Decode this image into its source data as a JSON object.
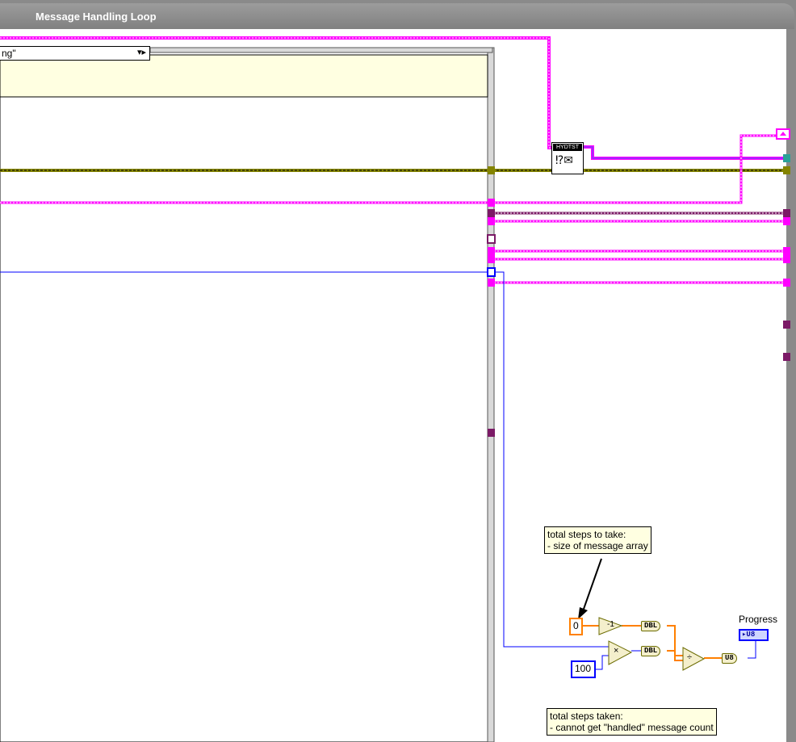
{
  "loop": {
    "title": "Message Handling Loop"
  },
  "case_structure": {
    "selector_text": "ng\"",
    "selector_arrow": "▾▸"
  },
  "subvi": {
    "label": "HYDTST",
    "icon": "message-queue-icon"
  },
  "comments": {
    "total_steps_to_take": {
      "line1": "total steps to take:",
      "line2": "- size of message array"
    },
    "total_steps_taken": {
      "line1": "total steps taken:",
      "line2": "- cannot get \"handled\" message count"
    }
  },
  "constants": {
    "zero": "0",
    "hundred": "100"
  },
  "nodes": {
    "decrement": "-1",
    "multiply": "×",
    "divide": "÷",
    "to_dbl_1": "DBL",
    "to_dbl_2": "DBL",
    "to_u8": "U8"
  },
  "indicator": {
    "label": "Progress",
    "type": "U8"
  },
  "colors": {
    "cluster_pink": "#ff00ff",
    "reference_purple": "#7b1a66",
    "error_olive": "#848400",
    "numeric_blue": "#0000ff",
    "numeric_orange": "#ff8000",
    "comment_yellow": "#ffffe1",
    "loop_gray": "#8a8a8a"
  }
}
